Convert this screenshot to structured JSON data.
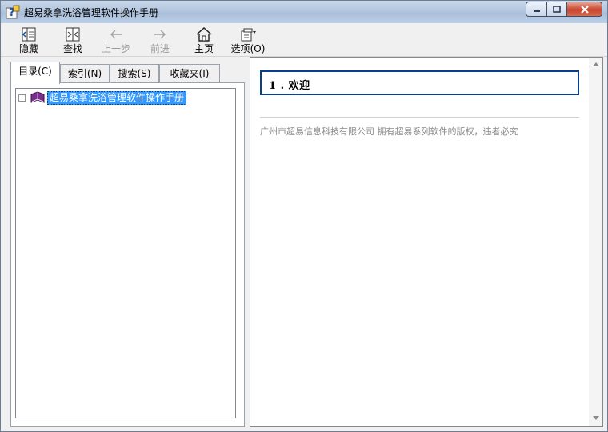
{
  "window": {
    "title": "超易桑拿洗浴管理软件操作手册"
  },
  "toolbar": {
    "hide_label": "隐藏",
    "find_label": "查找",
    "back_label": "上一步",
    "forward_label": "前进",
    "home_label": "主页",
    "options_label": "选项(O)"
  },
  "nav": {
    "tabs": [
      "目录(C)",
      "索引(N)",
      "搜索(S)",
      "收藏夹(I)"
    ],
    "active_tab": "目录(C)",
    "tree": [
      {
        "label": "超易桑拿洗浴管理软件操作手册",
        "expanded": false,
        "selected": true
      }
    ]
  },
  "content": {
    "heading": "1 . 欢迎",
    "copyright": "广州市超易信息科技有限公司 拥有超易系列软件的版权，违者必究"
  },
  "colors": {
    "selection": "#3399ff",
    "heading_border": "#0a3f8a",
    "close_button": "#c8442c"
  }
}
